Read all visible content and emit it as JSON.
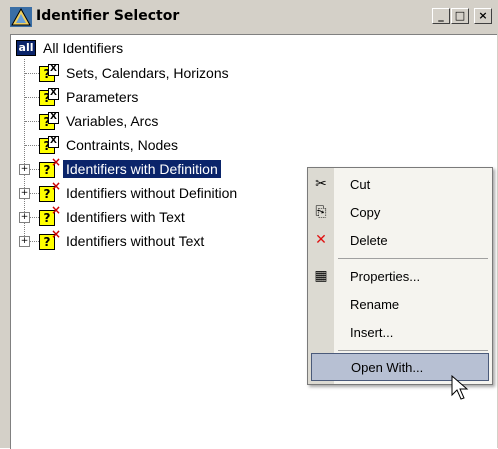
{
  "window": {
    "title": "Identifier Selector",
    "buttons": {
      "minimize": "_",
      "maximize": "□",
      "close": "×"
    }
  },
  "tree": {
    "root": {
      "label": "All Identifiers",
      "icon": "all-icon"
    },
    "items": [
      {
        "label": "Sets, Calendars, Horizons",
        "expandable": false
      },
      {
        "label": "Parameters",
        "expandable": false
      },
      {
        "label": "Variables, Arcs",
        "expandable": false
      },
      {
        "label": "Contraints, Nodes",
        "expandable": false
      },
      {
        "label": "Identifiers with Definition",
        "expandable": true,
        "selected": true
      },
      {
        "label": "Identifiers without Definition",
        "expandable": true
      },
      {
        "label": "Identifiers with Text",
        "expandable": true
      },
      {
        "label": "Identifiers without Text",
        "expandable": true
      }
    ]
  },
  "context_menu": {
    "items": [
      {
        "label": "Cut",
        "icon": "scissors-icon"
      },
      {
        "label": "Copy",
        "icon": "copy-icon"
      },
      {
        "label": "Delete",
        "icon": "delete-icon"
      },
      {
        "label": "Properties...",
        "icon": "properties-icon"
      },
      {
        "label": "Rename",
        "icon": ""
      },
      {
        "label": "Insert...",
        "icon": ""
      },
      {
        "label": "Open With...",
        "icon": "",
        "hovered": true
      }
    ]
  },
  "colors": {
    "selection": "#0a246a",
    "menu_hover": "#b7c0d3",
    "delete_red": "#e01010"
  }
}
